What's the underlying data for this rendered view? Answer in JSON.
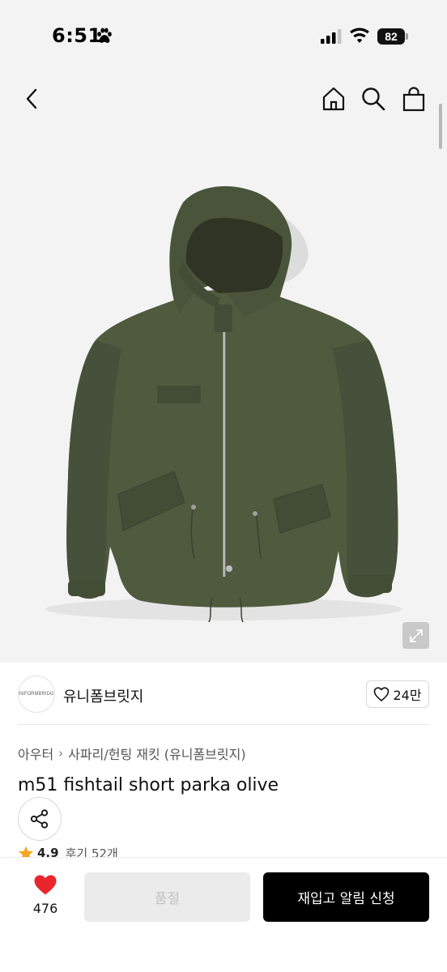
{
  "status_bar": {
    "time": "6:51",
    "battery": "82"
  },
  "nav": {
    "icons": [
      "back-icon",
      "home-icon",
      "search-icon",
      "shopping-bag-icon"
    ]
  },
  "product_image": {
    "alt": "olive green hooded zip-up parka",
    "jacket_color": "#4f5a3e"
  },
  "brand": {
    "logo_text": "UNIFORMBRIDGE",
    "name": "유니폼브릿지",
    "like_count": "24만"
  },
  "breadcrumb": {
    "category": "아우터",
    "subcategory": "사파리/헌팅 재킷 (유니폼브릿지)"
  },
  "product": {
    "title": "m51 fishtail short parka olive",
    "rating": "4.9",
    "reviews": "후기 52개"
  },
  "bottom_bar": {
    "wish_count": "476",
    "soldout_label": "품절",
    "restock_label": "재입고 알림 신청"
  },
  "colors": {
    "accent_red": "#e8262b",
    "star": "#f5a623",
    "primary_button": "#000000",
    "disabled_button": "#ebebeb"
  }
}
